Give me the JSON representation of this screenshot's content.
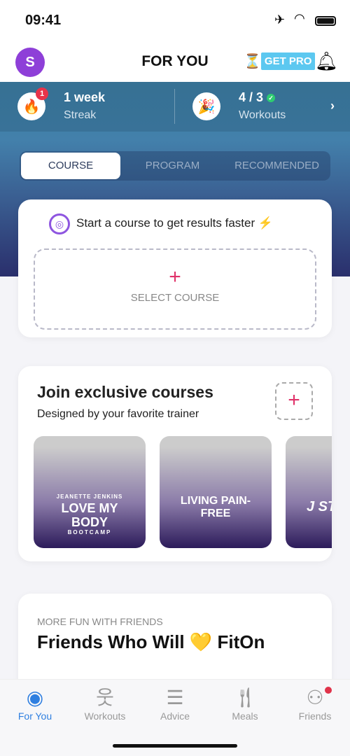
{
  "status": {
    "time": "09:41"
  },
  "header": {
    "avatar_initial": "S",
    "title": "FOR YOU",
    "pro_label": "GET PRO"
  },
  "stats": {
    "streak": {
      "value": "1 week",
      "label": "Streak",
      "badge": "1"
    },
    "workouts": {
      "value": "4 / 3",
      "label": "Workouts"
    }
  },
  "tabs": [
    {
      "label": "COURSE",
      "active": true
    },
    {
      "label": "PROGRAM"
    },
    {
      "label": "RECOMMENDED"
    }
  ],
  "course_card": {
    "prompt": "Start a course to get results faster",
    "select_label": "SELECT COURSE"
  },
  "exclusive": {
    "title": "Join exclusive courses",
    "subtitle": "Designed by your favorite trainer",
    "courses": [
      {
        "trainer": "JEANETTE JENKINS",
        "name": "LOVE MY BODY",
        "sub": "BOOTCAMP"
      },
      {
        "name": "LIVING PAIN-FREE"
      },
      {
        "name": "J STA"
      }
    ]
  },
  "friends": {
    "eyebrow": "MORE FUN WITH FRIENDS",
    "title": "Friends Who Will 💛 FitOn"
  },
  "nav": [
    {
      "label": "For You",
      "icon": "user-circle-icon",
      "active": true
    },
    {
      "label": "Workouts",
      "icon": "stretch-icon"
    },
    {
      "label": "Advice",
      "icon": "article-icon"
    },
    {
      "label": "Meals",
      "icon": "fork-knife-icon"
    },
    {
      "label": "Friends",
      "icon": "group-icon"
    }
  ],
  "colors": {
    "accent": "#2f7fe0",
    "avatar": "#8e3fd8",
    "pro": "#5cc8f0",
    "plus": "#e0336a"
  }
}
